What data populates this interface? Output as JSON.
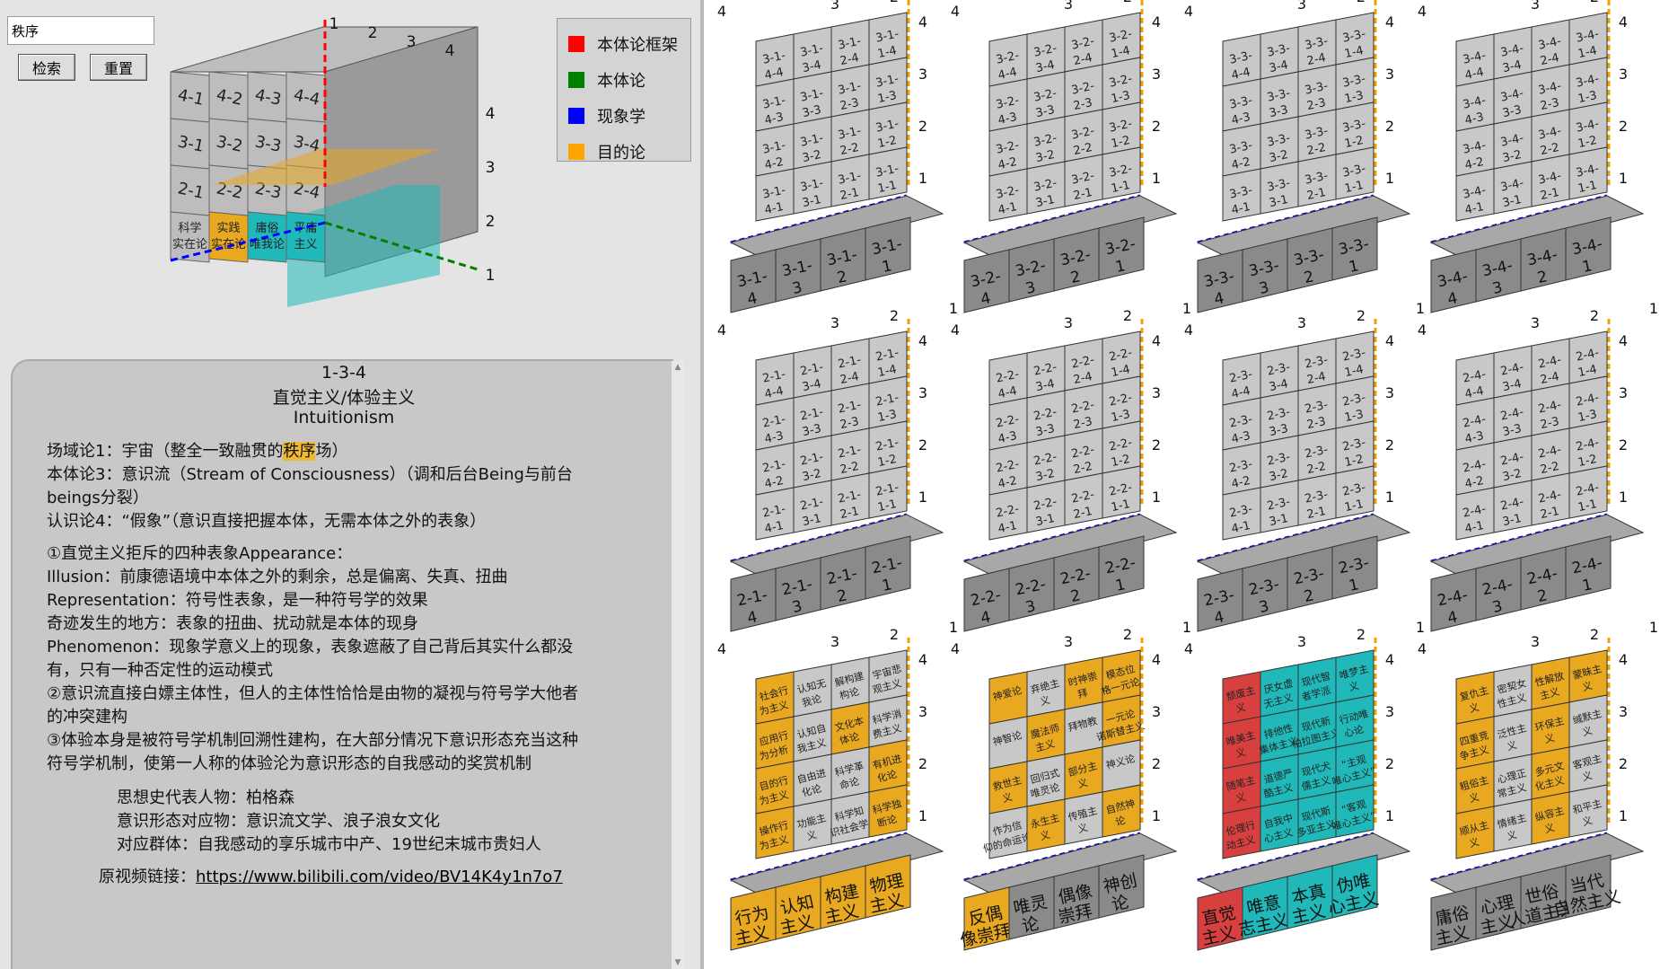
{
  "search": {
    "value": "秩序"
  },
  "buttons": {
    "search": "检索",
    "reset": "重置"
  },
  "legend": [
    {
      "label": "本体论框架",
      "color": "#ff0000"
    },
    {
      "label": "本体论",
      "color": "#008000"
    },
    {
      "label": "现象学",
      "color": "#0000ff"
    },
    {
      "label": "目的论",
      "color": "#ffa500"
    }
  ],
  "cube": {
    "top_numbers": [
      "1",
      "2",
      "3",
      "4"
    ],
    "side_numbers": [
      "4",
      "3",
      "2",
      "1"
    ],
    "faces": [
      [
        "4-1",
        "4-2",
        "4-3",
        "4-4"
      ],
      [
        "3-1",
        "3-2",
        "3-3",
        "3-4"
      ],
      [
        "2-1",
        "2-2",
        "2-3",
        "2-4"
      ]
    ],
    "bottom_labels": [
      "科学实在论",
      "实践实在论",
      "庸俗唯我论",
      "平庸主义"
    ]
  },
  "detail": {
    "code": "1-3-4",
    "title_cn": "直觉主义/体验主义",
    "title_en": "Intuitionism",
    "field": "场域论1：宇宙（整全一致融贯的",
    "field_hl": "秩序",
    "field_end": "场）",
    "ontology_1": "本体论3：意识流（Stream of Consciousness）（调和后台Being与前台",
    "ontology_2": "beings分裂）",
    "epistemology": "认识论4：“假象”（意识直接把握本体，无需本体之外的表象）",
    "p1": "①直觉主义拒斥的四种表象Appearance：",
    "p2": "Illusion：前康德语境中本体之外的剩余，总是偏离、失真、扭曲",
    "p3": "Representation：符号性表象，是一种符号学的效果",
    "p4": "奇迹发生的地方：表象的扭曲、扰动就是本体的现身",
    "p5": "Phenomenon：现象学意义上的现象，表象遮蔽了自己背后其实什么都没",
    "p6": "有，只有一种否定性的运动模式",
    "p7": "②意识流直接白嫖主体性，但人的主体性恰恰是由物的凝视与符号学大他者",
    "p8": "的冲突建构",
    "p9": "③体验本身是被符号学机制回溯性建构，在大部分情况下意识形态充当这种",
    "p10": "符号学机制，使第一人称的体验沦为意识形态的自我感动的奖赏机制",
    "figure": "思想史代表人物：柏格森",
    "ideology": "意识形态对应物：意识流文学、浪子浪女文化",
    "group": "对应群体：自我感动的享乐城市中产、19世纪末城市贵妇人",
    "link_label": "原视频链接：",
    "link": "https://www.bilibili.com/video/BV14K4y1n7o7"
  },
  "blocks": [
    {
      "prefix": "3-1",
      "face": [
        "3-1-4-4",
        "3-1-3-4",
        "3-1-2-4",
        "3-1-1-4"
      ],
      "bottom": [
        "3-1-4",
        "3-1-3",
        "3-1-2",
        "3-1-1"
      ]
    },
    {
      "prefix": "3-2",
      "face": [
        "3-2-4-4",
        "3-2-3-4",
        "3-2-2-4",
        "3-2-1-4"
      ],
      "bottom": [
        "3-2-4",
        "3-2-3",
        "3-2-2",
        "3-2-1"
      ]
    },
    {
      "prefix": "3-3",
      "face": [
        "3-3-4-4",
        "3-3-3-4",
        "3-3-2-4",
        "3-3-1-4"
      ],
      "bottom": [
        "3-3-4",
        "3-3-3",
        "3-3-2",
        "3-3-1"
      ]
    },
    {
      "prefix": "3-4",
      "face": [
        "3-4-4-4",
        "3-4-3-4",
        "3-4-2-4",
        "3-4-1-4"
      ],
      "bottom": [
        "3-4-4",
        "3-4-3",
        "3-4-2",
        "3-4-1"
      ]
    },
    {
      "prefix": "2-1",
      "face": [],
      "bottom": [
        "2-1-4",
        "2-1-3",
        "2-1-2",
        "2-1-1"
      ]
    },
    {
      "prefix": "2-2",
      "face": [],
      "bottom": [
        "2-2-4",
        "2-2-3",
        "2-2-2",
        "2-2-1"
      ]
    },
    {
      "prefix": "2-3",
      "face": [],
      "bottom": [
        "2-3-4",
        "2-3-3",
        "2-3-2",
        "2-3-1"
      ]
    },
    {
      "prefix": "2-4",
      "face": [],
      "bottom": [
        "2-4-4",
        "2-4-3",
        "2-4-2",
        "2-4-1"
      ]
    }
  ],
  "isms_row": [
    {
      "bottom": [
        "行为主义",
        "认知主义",
        "构建主义",
        "物理主义"
      ],
      "face": [
        [
          "社会行为主义",
          "认知无我论",
          "解构建构论",
          "宇宙悲观主义"
        ],
        [
          "应用行为分析",
          "认知自我主义",
          "文化本体论",
          "科学消费主义"
        ],
        [
          "目的行为主义",
          "自由进化论",
          "科学革命论",
          "有机进化论"
        ],
        [
          "操作行为主义",
          "功能主义",
          "科学知识社会学",
          "科学独断论"
        ]
      ],
      "color": "#e8a820"
    },
    {
      "bottom": [
        "反偶像崇拜",
        "唯灵论",
        "偶像崇拜",
        "神创论"
      ],
      "face": [
        [
          "神爱论",
          "弃绝主义",
          "时神崇拜",
          "模态位格一元论"
        ],
        [
          "神智论",
          "魔法师主义",
          "拜物教",
          "一元论诺斯替主义"
        ],
        [
          "救世主义",
          "回归式唯灵论",
          "部分主义",
          "神义论"
        ],
        [
          "作为信仰的命运论",
          "永生主义",
          "传殖主义",
          "自然神论"
        ]
      ],
      "color": "#e8a820"
    },
    {
      "bottom": [
        "直觉主义",
        "唯意志主义",
        "本真主义",
        "伪唯心主义"
      ],
      "face": [
        [
          "颓废主义",
          "厌女虚无主义",
          "现代智者学派",
          "唯梦主义"
        ],
        [
          "唯美主义",
          "排他性集体主义",
          "现代新柏拉图主义",
          "行动唯心论"
        ],
        [
          "随笔主义",
          "道德严酷主义",
          "现代犬儒主义",
          "“主观唯心主义”"
        ],
        [
          "伦理行动主义",
          "自我中心主义",
          "现代斯多亚主义",
          "“客观唯心主义”"
        ]
      ],
      "color": "#20b8b8"
    },
    {
      "bottom": [
        "庸俗主义",
        "心理主义",
        "世俗人道主义",
        "当代自然主义"
      ],
      "face": [
        [
          "复仇主义",
          "密契女性主义",
          "性解放主义",
          "蒙昧主义"
        ],
        [
          "四重竞争主义",
          "泛性主义",
          "环保主义",
          "缄默主义"
        ],
        [
          "粗俗主义",
          "心理正常主义",
          "多元文化主义",
          "客观主义"
        ],
        [
          "顺从主义",
          "情绪主义",
          "纵容主义",
          "和平主义"
        ]
      ],
      "color": "#e8a820"
    }
  ],
  "axis_numbers": {
    "top": [
      "4",
      "3",
      "2",
      "1"
    ],
    "side": [
      "4",
      "3",
      "2",
      "1"
    ]
  }
}
